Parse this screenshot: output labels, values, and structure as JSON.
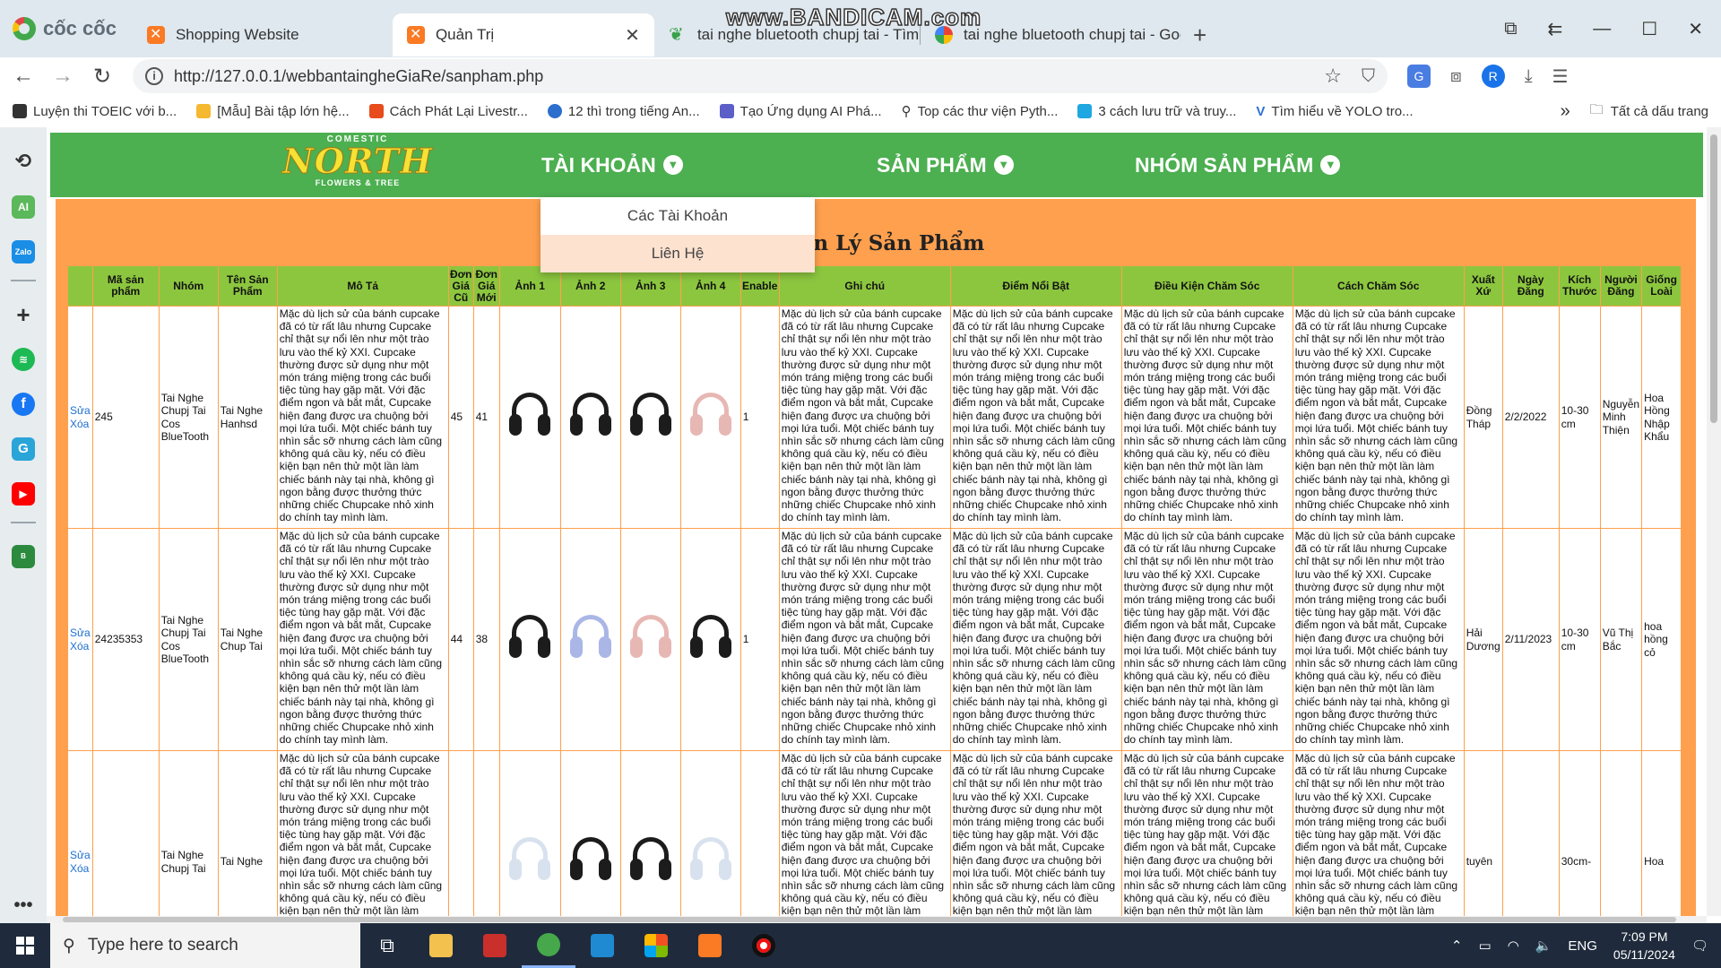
{
  "browser": {
    "brand": "cốc cốc",
    "tabs": [
      {
        "title": "Shopping Website",
        "icon": "xampp-icon"
      },
      {
        "title": "Quản Trị",
        "icon": "xampp-icon",
        "active": true
      },
      {
        "title": "tai nghe bluetooth chupj tai - Tìm",
        "icon": "coccoc-icon"
      },
      {
        "title": "tai nghe bluetooth chupj tai - Goo",
        "icon": "google-icon"
      }
    ],
    "watermark": "www.BANDICAM.com",
    "url": "http://127.0.0.1/webbantaingheGiaRe/sanpham.php",
    "bookmarks": [
      "Luyện thi TOEIC với b...",
      "[Mẫu] Bài tập lớn hệ...",
      "Cách Phát Lại Livestr...",
      "12 thì trong tiếng An...",
      "Tạo Ứng dụng AI Phá...",
      "Top các thư viện Pyth...",
      "3 cách lưu trữ và truy...",
      "Tìm hiểu về YOLO tro..."
    ],
    "all_bookmarks": "Tất cả dấu trang",
    "avatar_letter": "R"
  },
  "site": {
    "logo": {
      "top": "COMESTIC",
      "main": "NORTH",
      "tagline": "FLOWERS & TREE"
    },
    "menu": [
      "TÀI KHOẢN",
      "SẢN PHẨM",
      "NHÓM SẢN PHẨM"
    ],
    "dropdown": [
      "Các Tài Khoản",
      "Liên Hệ"
    ],
    "page_title": "Quản Lý Sản Phẩm",
    "headers": [
      "",
      "Mã sản phẩm",
      "Nhóm",
      "Tên Sản Phẩm",
      "Mô Tả",
      "Đơn Giá Cũ",
      "Đơn Giá Mới",
      "Ảnh 1",
      "Ảnh 2",
      "Ảnh 3",
      "Ảnh 4",
      "Enable",
      "Ghi chú",
      "Điểm Nổi Bật",
      "Điều Kiện Chăm Sóc",
      "Cách Chăm Sóc",
      "Xuất Xứ",
      "Ngày Đăng",
      "Kích Thước",
      "Người Đăng",
      "Giống Loài"
    ],
    "long_text": "Mặc dù lịch sử của bánh cupcake đã có từ rất lâu nhưng Cupcake chỉ thật sự nổi lên như một trào lưu vào thế kỷ XXI. Cupcake thường được sử dụng như một món tráng miệng trong các buổi tiệc tùng hay gặp mặt. Với đặc điểm ngon và bắt mắt, Cupcake hiện đang được ưa chuộng bởi mọi lứa tuổi. Một chiếc bánh tuy nhìn sắc sỡ nhưng cách làm cũng không quá cầu kỳ, nếu có điều kiện bạn nên thử một lần làm chiếc bánh này tại nhà, không gì ngon bằng được thưởng thức những chiếc Chupcake nhỏ xinh do chính tay mình làm.",
    "edit_label": "Sửa",
    "delete_label": "Xóa",
    "rows": [
      {
        "ma": "245",
        "nhom": "Tai Nghe Chupj Tai Cos BlueTooth",
        "ten": "Tai Nghe Hanhsd",
        "cu": "45",
        "moi": "41",
        "enable": "1",
        "xuatxu": "Đồng Tháp",
        "ngay": "2/2/2022",
        "kichthuoc": "10-30 cm",
        "nguoidang": "Nguyễn Minh Thiện",
        "giong": "Hoa Hồng Nhập Khẩu",
        "imgs": [
          "black",
          "black",
          "black",
          "pink"
        ]
      },
      {
        "ma": "24235353",
        "nhom": "Tai Nghe Chupj Tai Cos BlueTooth",
        "ten": "Tai Nghe Chup Tai",
        "cu": "44",
        "moi": "38",
        "enable": "1",
        "xuatxu": "Hải Dương",
        "ngay": "2/11/2023",
        "kichthuoc": "10-30 cm",
        "nguoidang": "Vũ Thị Bắc",
        "giong": "hoa hồng cỏ",
        "imgs": [
          "black",
          "blue",
          "pink",
          "black"
        ]
      },
      {
        "ma": "",
        "nhom": "Tai Nghe Chupj Tai",
        "ten": "Tai Nghe",
        "cu": "",
        "moi": "",
        "enable": "",
        "xuatxu": "tuyên",
        "ngay": "",
        "kichthuoc": "30cm-",
        "nguoidang": "",
        "giong": "Hoa",
        "imgs": [
          "white",
          "black",
          "black",
          "white"
        ]
      }
    ]
  },
  "taskbar": {
    "search_placeholder": "Type here to search",
    "language": "ENG",
    "time": "7:09 PM",
    "date": "05/11/2024"
  }
}
